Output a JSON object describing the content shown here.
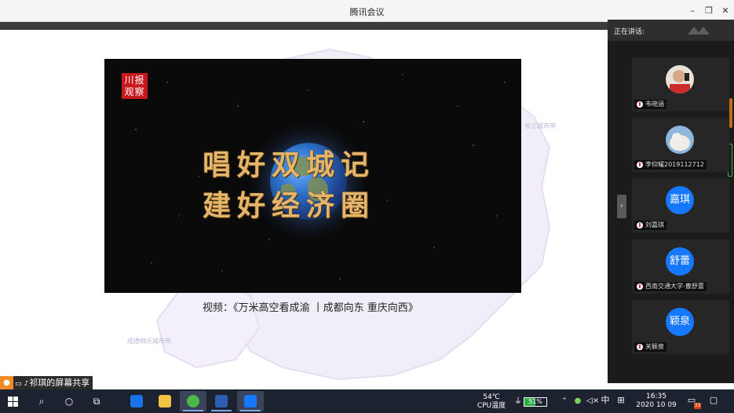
{
  "window": {
    "title": "腾讯会议",
    "minimize_glyph": "–",
    "restore_glyph": "❐",
    "close_glyph": "✕"
  },
  "video": {
    "logo_text": "川报观察",
    "line1": "唱好双城记",
    "line2": "建好经济圈"
  },
  "background_map": {
    "labels": [
      "长江城市带",
      "成德绵乐城市带"
    ]
  },
  "caption": "视频：《万米高空看成渝 丨成都向东 重庆向西》",
  "panel": {
    "speaking_label": "正在讲话:",
    "expand_glyph": "›",
    "participants": [
      {
        "name": "韦晓涵",
        "avatar_text": "",
        "avatar_type": "photo-person"
      },
      {
        "name": "李仰耀2019112712",
        "avatar_text": "",
        "avatar_type": "photo-animal"
      },
      {
        "name": "刘嘉琪",
        "avatar_text": "嘉琪",
        "avatar_type": "initials"
      },
      {
        "name": "西南交通大学-曹舒蕾",
        "avatar_text": "舒蕾",
        "avatar_type": "initials"
      },
      {
        "name": "关颖泉",
        "avatar_text": "颖泉",
        "avatar_type": "initials"
      }
    ]
  },
  "share_notice": "祁琪的屏幕共享",
  "taskbar": {
    "start_icon": "windows-logo-icon",
    "temp": "54℃",
    "temp_label": "CPU温度",
    "battery": "51%",
    "battery_level": 0.51,
    "ime": "中",
    "time": "16:35",
    "date": "2020 10 09",
    "notif_count": "33"
  },
  "colors": {
    "accent": "#1678ff",
    "video_text": "#e4b56b",
    "taskbar": "#1c2230"
  }
}
